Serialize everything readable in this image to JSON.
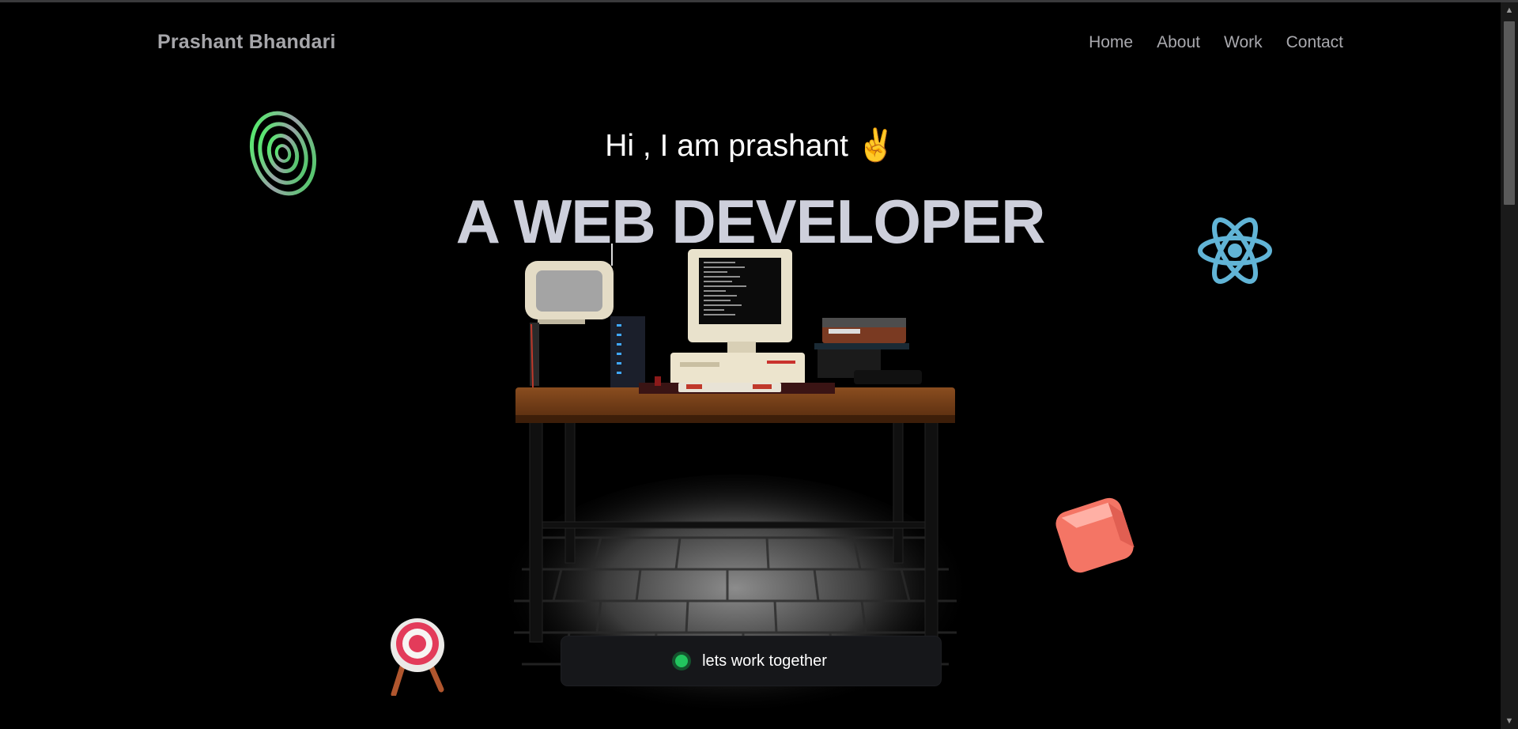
{
  "brand": {
    "name": "Prashant Bhandari"
  },
  "nav": {
    "items": [
      {
        "label": "Home"
      },
      {
        "label": "About"
      },
      {
        "label": "Work"
      },
      {
        "label": "Contact"
      }
    ]
  },
  "hero": {
    "greeting": "Hi , I am prashant",
    "greeting_emoji": "✌️",
    "headline": "A WEB DEVELOPER"
  },
  "scene": {
    "objects": [
      "crt-tv",
      "retro-computer",
      "keyboard",
      "wooden-desk",
      "vintage-radio",
      "server-rack",
      "stone-floor"
    ]
  },
  "floating_icons": [
    "target-icon",
    "react-icon",
    "cube-icon",
    "ring-icon"
  ],
  "cta": {
    "label": "lets work together",
    "status_color": "#22c55e"
  },
  "colors": {
    "background": "#000000",
    "brand_text": "#a6a6aa",
    "headline": "#cdcfdb",
    "react": "#61b4d6",
    "cube": "#f87f6e",
    "ring": "#22c55e"
  }
}
